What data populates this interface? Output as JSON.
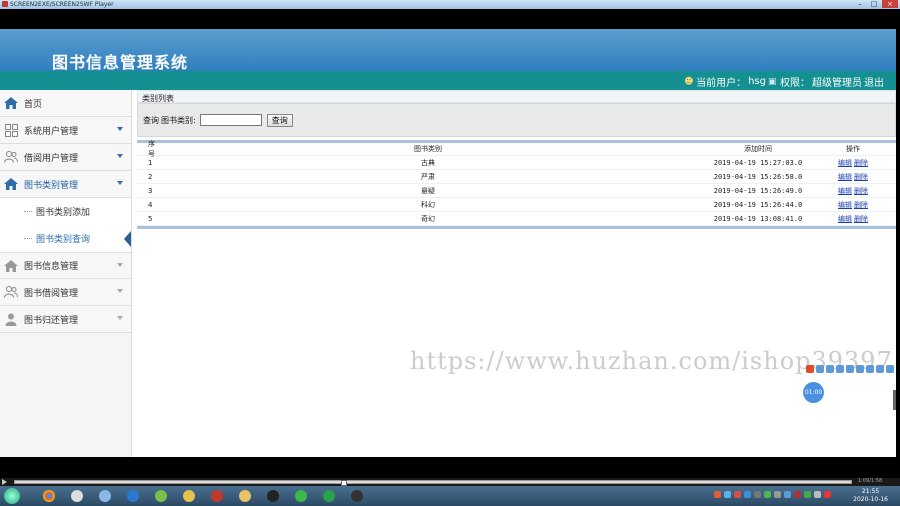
{
  "player": {
    "title": "SCREEN2EXE/SCREEN2SWF Player",
    "minimize_glyph": "–",
    "maximize_glyph": "□",
    "close_glyph": "×"
  },
  "app": {
    "title": "图书信息管理系统",
    "user_label": "当前用户：",
    "user_name": "hsg",
    "role_label": "权限：",
    "role_value": "超级管理员",
    "logout_label": "退出"
  },
  "sidebar": {
    "home": "首页",
    "items": [
      {
        "label": "系统用户管理",
        "icon": "grid-icon"
      },
      {
        "label": "借阅用户管理",
        "icon": "users-icon"
      },
      {
        "label": "图书类别管理",
        "icon": "home-icon"
      },
      {
        "label": "图书信息管理",
        "icon": "home-icon"
      },
      {
        "label": "图书借阅管理",
        "icon": "users-icon"
      },
      {
        "label": "图书归还管理",
        "icon": "user-icon"
      }
    ],
    "sub_items": [
      {
        "label": "图书类别添加"
      },
      {
        "label": "图书类别查询"
      }
    ]
  },
  "main": {
    "section_title": "类别列表",
    "search_label": "查询",
    "field_label": "图书类别:",
    "search_value": "",
    "search_button": "查询",
    "columns": [
      "序号",
      "图书类别",
      "添加时间",
      "操作"
    ],
    "rows": [
      {
        "no": "1",
        "category": "古典",
        "time": "2019-04-19 15:27:03.0",
        "edit": "编辑",
        "delete": "删除"
      },
      {
        "no": "2",
        "category": "严肃",
        "time": "2019-04-19 15:26:58.0",
        "edit": "编辑",
        "delete": "删除"
      },
      {
        "no": "3",
        "category": "悬疑",
        "time": "2019-04-19 15:26:49.0",
        "edit": "编辑",
        "delete": "删除"
      },
      {
        "no": "4",
        "category": "科幻",
        "time": "2019-04-19 15:26:44.0",
        "edit": "编辑",
        "delete": "删除"
      },
      {
        "no": "5",
        "category": "奇幻",
        "time": "2019-04-19 13:08:41.0",
        "edit": "编辑",
        "delete": "删除"
      }
    ]
  },
  "watermark": "https://www.huzhan.com/ishop39397",
  "timer_bubble": "01:00",
  "control": {
    "time": "1:09/1:58"
  },
  "taskbar": {
    "time": "21:55",
    "date": "2020-10-16"
  },
  "colors": {
    "header": "#2f7fbf",
    "userbar": "#148f92",
    "link": "#1a3fb3",
    "accent": "#2a6fb2"
  }
}
